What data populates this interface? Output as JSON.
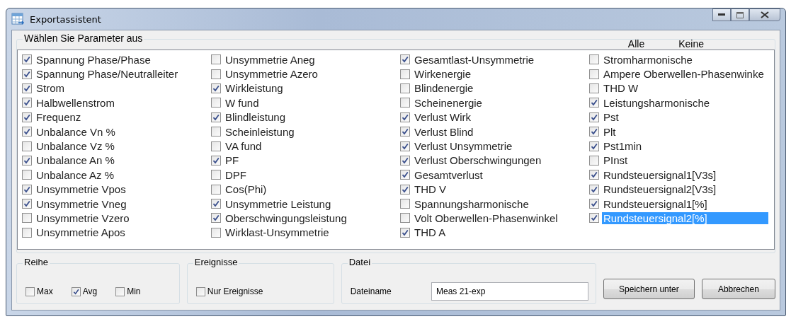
{
  "window": {
    "title": "Exportassistent"
  },
  "parameters": {
    "title": "Wählen Sie Parameter aus",
    "all_label": "Alle",
    "none_label": "Keine",
    "columns": [
      [
        {
          "label": "Spannung Phase/Phase",
          "checked": true,
          "selected": false
        },
        {
          "label": "Spannung Phase/Neutralleiter",
          "checked": true,
          "selected": false
        },
        {
          "label": "Strom",
          "checked": true,
          "selected": false
        },
        {
          "label": "Halbwellenstrom",
          "checked": true,
          "selected": false
        },
        {
          "label": "Frequenz",
          "checked": true,
          "selected": false
        },
        {
          "label": "Unbalance Vn %",
          "checked": true,
          "selected": false
        },
        {
          "label": "Unbalance Vz %",
          "checked": false,
          "selected": false
        },
        {
          "label": "Unbalance An %",
          "checked": true,
          "selected": false
        },
        {
          "label": "Unbalance Az %",
          "checked": false,
          "selected": false
        },
        {
          "label": "Unsymmetrie Vpos",
          "checked": true,
          "selected": false
        },
        {
          "label": "Unsymmetrie Vneg",
          "checked": true,
          "selected": false
        },
        {
          "label": "Unsymmetrie Vzero",
          "checked": false,
          "selected": false
        },
        {
          "label": "Unsymmetrie Apos",
          "checked": false,
          "selected": false
        }
      ],
      [
        {
          "label": "Unsymmetrie Aneg",
          "checked": false,
          "selected": false
        },
        {
          "label": "Unsymmetrie Azero",
          "checked": false,
          "selected": false
        },
        {
          "label": "Wirkleistung",
          "checked": true,
          "selected": false
        },
        {
          "label": "W fund",
          "checked": false,
          "selected": false
        },
        {
          "label": "Blindleistung",
          "checked": true,
          "selected": false
        },
        {
          "label": "Scheinleistung",
          "checked": false,
          "selected": false
        },
        {
          "label": "VA fund",
          "checked": false,
          "selected": false
        },
        {
          "label": "PF",
          "checked": true,
          "selected": false
        },
        {
          "label": "DPF",
          "checked": false,
          "selected": false
        },
        {
          "label": "Cos(Phi)",
          "checked": false,
          "selected": false
        },
        {
          "label": "Unsymmetrie Leistung",
          "checked": true,
          "selected": false
        },
        {
          "label": "Oberschwingungsleistung",
          "checked": true,
          "selected": false
        },
        {
          "label": "Wirklast-Unsymmetrie",
          "checked": false,
          "selected": false
        }
      ],
      [
        {
          "label": "Gesamtlast-Unsymmetrie",
          "checked": true,
          "selected": false
        },
        {
          "label": "Wirkenergie",
          "checked": false,
          "selected": false
        },
        {
          "label": "Blindenergie",
          "checked": false,
          "selected": false
        },
        {
          "label": "Scheinenergie",
          "checked": false,
          "selected": false
        },
        {
          "label": "Verlust Wirk",
          "checked": true,
          "selected": false
        },
        {
          "label": "Verlust Blind",
          "checked": true,
          "selected": false
        },
        {
          "label": "Verlust Unsymmetrie",
          "checked": true,
          "selected": false
        },
        {
          "label": "Verlust Oberschwingungen",
          "checked": true,
          "selected": false
        },
        {
          "label": "Gesamtverlust",
          "checked": true,
          "selected": false
        },
        {
          "label": "THD V",
          "checked": true,
          "selected": false
        },
        {
          "label": "Spannungsharmonische",
          "checked": false,
          "selected": false
        },
        {
          "label": "Volt Oberwellen-Phasenwinkel",
          "checked": false,
          "selected": false
        },
        {
          "label": "THD A",
          "checked": true,
          "selected": false
        }
      ],
      [
        {
          "label": "Stromharmonische",
          "checked": false,
          "selected": false
        },
        {
          "label": "Ampere Oberwellen-Phasenwinke",
          "checked": false,
          "selected": false
        },
        {
          "label": "THD W",
          "checked": false,
          "selected": false
        },
        {
          "label": "Leistungsharmonische",
          "checked": true,
          "selected": false
        },
        {
          "label": "Pst",
          "checked": true,
          "selected": false
        },
        {
          "label": "Plt",
          "checked": true,
          "selected": false
        },
        {
          "label": "Pst1min",
          "checked": true,
          "selected": false
        },
        {
          "label": "PInst",
          "checked": false,
          "selected": false
        },
        {
          "label": "Rundsteuersignal1[V3s]",
          "checked": true,
          "selected": false
        },
        {
          "label": "Rundsteuersignal2[V3s]",
          "checked": true,
          "selected": false
        },
        {
          "label": "Rundsteuersignal1[%]",
          "checked": true,
          "selected": false
        },
        {
          "label": "Rundsteuersignal2[%]",
          "checked": true,
          "selected": true
        }
      ]
    ]
  },
  "series": {
    "title": "Reihe",
    "options": [
      {
        "label": "Max",
        "checked": false
      },
      {
        "label": "Avg",
        "checked": true
      },
      {
        "label": "Min",
        "checked": false
      }
    ]
  },
  "events": {
    "title": "Ereignisse",
    "options": [
      {
        "label": "Nur Ereignisse",
        "checked": false
      }
    ]
  },
  "file": {
    "title": "Datei",
    "label": "Dateiname",
    "value": "Meas 21-exp"
  },
  "buttons": [
    "Speichern unter",
    "Abbrechen"
  ]
}
